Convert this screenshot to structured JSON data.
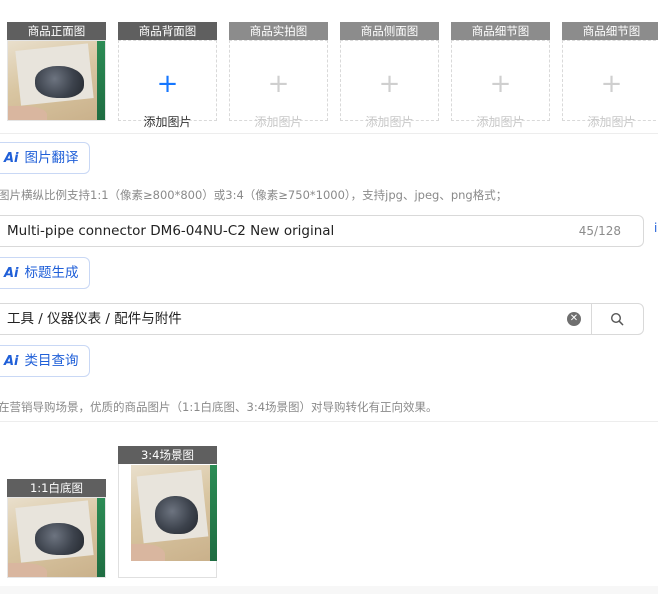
{
  "image_slots": [
    {
      "caption": "商品正面图",
      "filled": true
    },
    {
      "caption": "商品背面图",
      "add_text": "添加图片",
      "active": true
    },
    {
      "caption": "商品实拍图",
      "add_text": "添加图片"
    },
    {
      "caption": "商品侧面图",
      "add_text": "添加图片"
    },
    {
      "caption": "商品细节图",
      "add_text": "添加图片"
    },
    {
      "caption": "商品细节图",
      "add_text": "添加图片"
    }
  ],
  "ai_buttons": {
    "image_translate": "图片翻译",
    "title_generate": "标题生成",
    "category_query": "类目查询",
    "ai_mark": "Ai"
  },
  "image_hint": "图片横纵比例支持1:1（像素≥800*800）或3:4（像素≥750*1000），支持jpg、jpeg、png格式；",
  "title_field": {
    "value": "Multi-pipe connector DM6-04NU-C2 New original",
    "counter": "45/128",
    "edge_char": "i"
  },
  "category_field": {
    "value": "工具 / 仪器仪表 / 配件与附件",
    "clear_icon": "clear-icon",
    "search_icon": "search-icon"
  },
  "scene_hint": "在营销导购场景，优质的商品图片（1:1白底图、3:4场景图）对导购转化有正向效果。",
  "scene_images": [
    {
      "caption": "1:1白底图"
    },
    {
      "caption": "3:4场景图"
    }
  ],
  "colors": {
    "accent": "#1677ff",
    "ai_text": "#1f5fd8",
    "caption_bg": "#8c8c8c",
    "caption_bg_dark": "#5f5f5f"
  }
}
